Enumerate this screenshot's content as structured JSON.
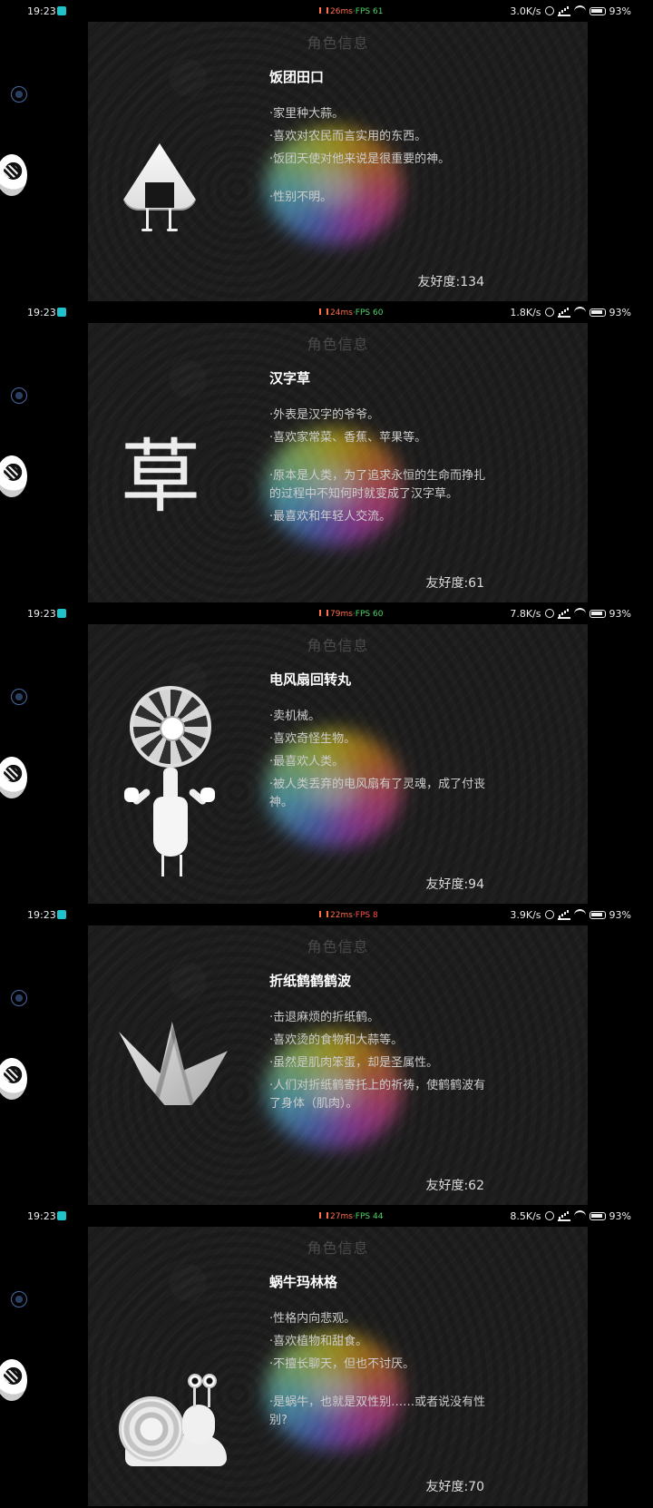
{
  "frames": [
    {
      "status": {
        "time": "19:23",
        "ms": "26ms",
        "separator": "·",
        "fps": "FPS 61",
        "fps_state": "good",
        "network": "3.0K/s",
        "battery": "93%"
      },
      "card": {
        "header": "角色信息",
        "name": "饭团田口",
        "traits": [
          "·家里种大蒜。",
          "·喜欢对农民而言实用的东西。",
          "·饭团天使对他来说是很重要的神。",
          "",
          "·性别不明。"
        ],
        "affinity_label": "友好度:",
        "affinity_value": "134",
        "illustration": "onigiri-icon"
      }
    },
    {
      "status": {
        "time": "19:23",
        "ms": "24ms",
        "separator": "·",
        "fps": "FPS 60",
        "fps_state": "good",
        "network": "1.8K/s",
        "battery": "93%"
      },
      "card": {
        "header": "角色信息",
        "name": "汉字草",
        "traits": [
          "·外表是汉字的爷爷。",
          "·喜欢家常菜、香蕉、苹果等。",
          "",
          "·原本是人类，为了追求永恒的生命而挣扎的过程中不知何时就变成了汉字草。",
          "·最喜欢和年轻人交流。"
        ],
        "affinity_label": "友好度:",
        "affinity_value": "61",
        "illustration_text": "草",
        "illustration": "kanji-grass-icon"
      }
    },
    {
      "status": {
        "time": "19:23",
        "ms": "79ms",
        "separator": "·",
        "fps": "FPS 60",
        "fps_state": "good",
        "network": "7.8K/s",
        "battery": "93%"
      },
      "card": {
        "header": "角色信息",
        "name": "电风扇回转丸",
        "traits": [
          "·卖机械。",
          "·喜欢奇怪生物。",
          "·最喜欢人类。",
          "·被人类丢弃的电风扇有了灵魂，成了付丧神。"
        ],
        "affinity_label": "友好度:",
        "affinity_value": "94",
        "illustration": "electric-fan-icon"
      }
    },
    {
      "status": {
        "time": "19:23",
        "ms": "22ms",
        "separator": "·",
        "fps": "FPS 8",
        "fps_state": "bad",
        "network": "3.9K/s",
        "battery": "93%"
      },
      "card": {
        "header": "角色信息",
        "name": "折纸鹤鹤鹤波",
        "traits": [
          "·击退麻烦的折纸鹤。",
          "·喜欢烫的食物和大蒜等。",
          "·虽然是肌肉笨蛋，却是圣属性。",
          "·人们对折纸鹤寄托上的祈祷，使鹤鹤波有了身体（肌肉）。"
        ],
        "affinity_label": "友好度:",
        "affinity_value": "62",
        "illustration": "paper-crane-icon"
      }
    },
    {
      "status": {
        "time": "19:23",
        "ms": "27ms",
        "separator": "·",
        "fps": "FPS 44",
        "fps_state": "good",
        "network": "8.5K/s",
        "battery": "93%"
      },
      "card": {
        "header": "角色信息",
        "name": "蜗牛玛林格",
        "traits": [
          "·性格内向悲观。",
          "·喜欢植物和甜食。",
          "·不擅长聊天，但也不讨厌。",
          "",
          "·是蜗牛，也就是双性别……或者说没有性别?"
        ],
        "affinity_label": "友好度:",
        "affinity_value": "70",
        "illustration": "snail-icon"
      }
    }
  ]
}
